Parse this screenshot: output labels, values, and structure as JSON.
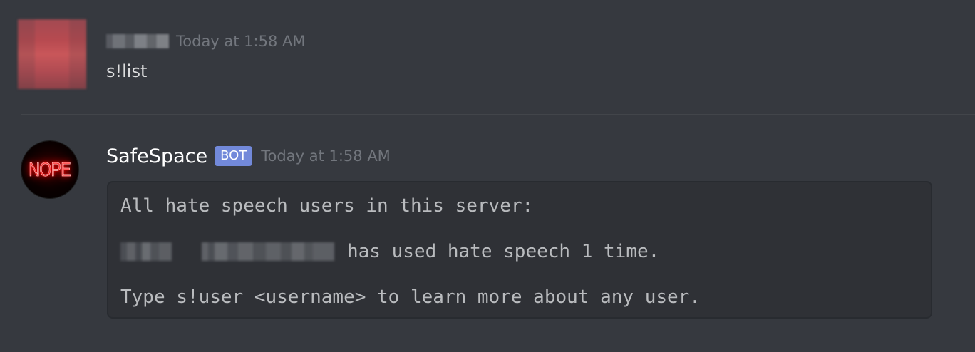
{
  "user_message": {
    "timestamp": "Today at 1:58 AM",
    "content": "s!list"
  },
  "bot_message": {
    "username": "SafeSpace",
    "bot_tag": "BOT",
    "timestamp": "Today at 1:58 AM",
    "avatar_text": "NOPE",
    "code_block": {
      "line1": "All hate speech users in this server:",
      "line2_suffix": "has used hate speech 1 time.",
      "line3": "Type s!user <username> to learn more about any user."
    }
  },
  "colors": {
    "background": "#36393f",
    "bot_tag": "#7289da",
    "codeblock_bg": "#2f3136",
    "timestamp": "#72767d",
    "neon_red": "#ff3b3b"
  }
}
